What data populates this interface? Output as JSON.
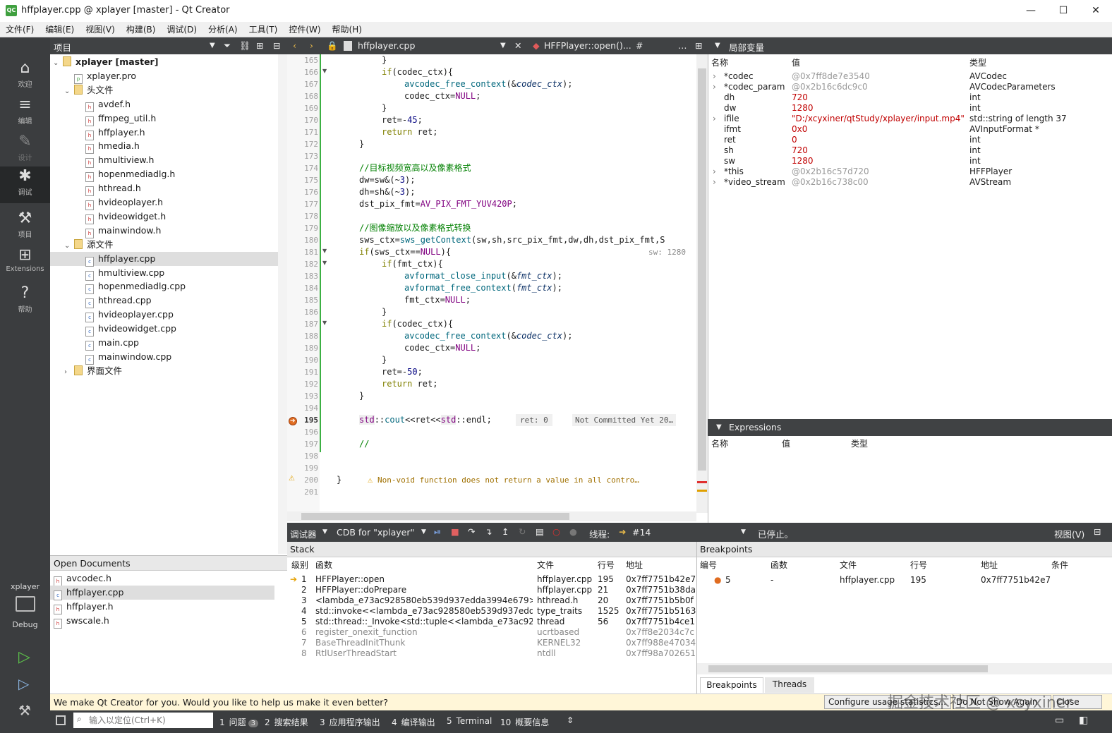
{
  "window": {
    "title": "hffplayer.cpp @ xplayer [master] - Qt Creator",
    "logo": "QC"
  },
  "menu": [
    "文件(F)",
    "编辑(E)",
    "视图(V)",
    "构建(B)",
    "调试(D)",
    "分析(A)",
    "工具(T)",
    "控件(W)",
    "帮助(H)"
  ],
  "modes": [
    {
      "label": "欢迎",
      "icon": "⌂"
    },
    {
      "label": "编辑",
      "icon": "≡"
    },
    {
      "label": "设计",
      "icon": "✎"
    },
    {
      "label": "调试",
      "icon": "✱"
    },
    {
      "label": "项目",
      "icon": "⚒"
    },
    {
      "label": "Extensions",
      "icon": "⊞"
    },
    {
      "label": "帮助",
      "icon": "?"
    }
  ],
  "kit": {
    "project": "xplayer",
    "config": "Debug"
  },
  "project_panel": {
    "title": "项目"
  },
  "tree": [
    {
      "label": "xplayer [master]",
      "level": 0,
      "type": "project"
    },
    {
      "label": "xplayer.pro",
      "level": 1,
      "type": "pro"
    },
    {
      "label": "头文件",
      "level": 1,
      "type": "folder"
    },
    {
      "label": "avdef.h",
      "level": 2,
      "type": "h"
    },
    {
      "label": "ffmpeg_util.h",
      "level": 2,
      "type": "h"
    },
    {
      "label": "hffplayer.h",
      "level": 2,
      "type": "h"
    },
    {
      "label": "hmedia.h",
      "level": 2,
      "type": "h"
    },
    {
      "label": "hmultiview.h",
      "level": 2,
      "type": "h"
    },
    {
      "label": "hopenmediadlg.h",
      "level": 2,
      "type": "h"
    },
    {
      "label": "hthread.h",
      "level": 2,
      "type": "h"
    },
    {
      "label": "hvideoplayer.h",
      "level": 2,
      "type": "h"
    },
    {
      "label": "hvideowidget.h",
      "level": 2,
      "type": "h"
    },
    {
      "label": "mainwindow.h",
      "level": 2,
      "type": "h"
    },
    {
      "label": "源文件",
      "level": 1,
      "type": "folder"
    },
    {
      "label": "hffplayer.cpp",
      "level": 2,
      "type": "cpp"
    },
    {
      "label": "hmultiview.cpp",
      "level": 2,
      "type": "cpp"
    },
    {
      "label": "hopenmediadlg.cpp",
      "level": 2,
      "type": "cpp"
    },
    {
      "label": "hthread.cpp",
      "level": 2,
      "type": "cpp"
    },
    {
      "label": "hvideoplayer.cpp",
      "level": 2,
      "type": "cpp"
    },
    {
      "label": "hvideowidget.cpp",
      "level": 2,
      "type": "cpp"
    },
    {
      "label": "main.cpp",
      "level": 2,
      "type": "cpp"
    },
    {
      "label": "mainwindow.cpp",
      "level": 2,
      "type": "cpp"
    },
    {
      "label": "界面文件",
      "level": 1,
      "type": "folder"
    }
  ],
  "open_documents": {
    "title": "Open Documents",
    "items": [
      "avcodec.h",
      "hffplayer.cpp",
      "hffplayer.h",
      "swscale.h"
    ]
  },
  "editor": {
    "file": "hffplayer.cpp",
    "symbol": "HFFPlayer::open()...",
    "hash": "#",
    "line_numbers": [
      "165",
      "166",
      "167",
      "168",
      "169",
      "170",
      "171",
      "172",
      "173",
      "174",
      "175",
      "176",
      "177",
      "178",
      "179",
      "180",
      "181",
      "182",
      "183",
      "184",
      "185",
      "186",
      "187",
      "188",
      "189",
      "190",
      "191",
      "192",
      "193",
      "194",
      "195",
      "196",
      "197",
      "198",
      "199",
      "200",
      "201"
    ],
    "annotations": {
      "sw": "sw: 1280",
      "ret": "ret: 0",
      "not_committed": "Not Committed Yet 20…",
      "warning": "Non-void function does not return a value in all contro…"
    }
  },
  "locals": {
    "title": "局部变量",
    "headers": [
      "名称",
      "值",
      "类型"
    ],
    "rows": [
      {
        "name": "*codec",
        "value": "@0x7ff8de7e3540",
        "type": "AVCodec",
        "expand": true,
        "grey": true
      },
      {
        "name": "*codec_param",
        "value": "@0x2b16c6dc9c0",
        "type": "AVCodecParameters",
        "expand": true,
        "grey": true
      },
      {
        "name": "dh",
        "value": "720",
        "type": "int",
        "expand": false,
        "grey": false
      },
      {
        "name": "dw",
        "value": "1280",
        "type": "int",
        "expand": false,
        "grey": false
      },
      {
        "name": "ifile",
        "value": "\"D:/xcyxiner/qtStudy/xplayer/input.mp4\"",
        "type": "std::string of length 37",
        "expand": true,
        "grey": false
      },
      {
        "name": "ifmt",
        "value": "0x0",
        "type": "AVInputFormat *",
        "expand": false,
        "grey": false
      },
      {
        "name": "ret",
        "value": "0",
        "type": "int",
        "expand": false,
        "grey": false
      },
      {
        "name": "sh",
        "value": "720",
        "type": "int",
        "expand": false,
        "grey": false
      },
      {
        "name": "sw",
        "value": "1280",
        "type": "int",
        "expand": false,
        "grey": false
      },
      {
        "name": "*this",
        "value": "@0x2b16c57d720",
        "type": "HFFPlayer",
        "expand": true,
        "grey": true
      },
      {
        "name": "*video_stream",
        "value": "@0x2b16c738c00",
        "type": "AVStream",
        "expand": true,
        "grey": true
      }
    ]
  },
  "expressions": {
    "title": "Expressions",
    "headers": [
      "名称",
      "值",
      "类型"
    ]
  },
  "debugger_bar": {
    "debugger": "调试器",
    "engine": "CDB for \"xplayer\"",
    "thread_label": "线程:",
    "thread": "#14",
    "state": "已停止。",
    "view": "视图(V)"
  },
  "stack": {
    "title": "Stack",
    "headers": [
      "级别",
      "函数",
      "文件",
      "行号",
      "地址"
    ],
    "rows": [
      {
        "level": "1",
        "func": "HFFPlayer::open",
        "file": "hffplayer.cpp",
        "line": "195",
        "addr": "0x7ff7751b42e7",
        "grey": false,
        "current": true
      },
      {
        "level": "2",
        "func": "HFFPlayer::doPrepare",
        "file": "hffplayer.cpp",
        "line": "21",
        "addr": "0x7ff7751b38da",
        "grey": false,
        "current": false
      },
      {
        "level": "3",
        "func": "<lambda_e73ac928580eb539d937edda3994e679>::…",
        "file": "hthread.h",
        "line": "20",
        "addr": "0x7ff7751b5b0f",
        "grey": false,
        "current": false
      },
      {
        "level": "4",
        "func": "std::invoke<<lambda_e73ac928580eb539d937edd…",
        "file": "type_traits",
        "line": "1525",
        "addr": "0x7ff7751b5163",
        "grey": false,
        "current": false
      },
      {
        "level": "5",
        "func": "std::thread::_Invoke<std::tuple<<lambda_e73ac928…",
        "file": "thread",
        "line": "56",
        "addr": "0x7ff7751b4ce1",
        "grey": false,
        "current": false
      },
      {
        "level": "6",
        "func": "register_onexit_function",
        "file": "ucrtbased",
        "line": "",
        "addr": "0x7ff8e2034c7c",
        "grey": true,
        "current": false
      },
      {
        "level": "7",
        "func": "BaseThreadInitThunk",
        "file": "KERNEL32",
        "line": "",
        "addr": "0x7ff988e47034",
        "grey": true,
        "current": false
      },
      {
        "level": "8",
        "func": "RtlUserThreadStart",
        "file": "ntdll",
        "line": "",
        "addr": "0x7ff98a702651",
        "grey": true,
        "current": false
      }
    ]
  },
  "breakpoints": {
    "title": "Breakpoints",
    "headers": [
      "编号",
      "函数",
      "文件",
      "行号",
      "地址",
      "条件"
    ],
    "rows": [
      {
        "num": "5",
        "func": "-",
        "file": "hffplayer.cpp",
        "line": "195",
        "addr": "0x7ff7751b42e7",
        "cond": ""
      }
    ],
    "tabs": [
      "Breakpoints",
      "Threads"
    ]
  },
  "notice": {
    "text": "We make Qt Creator for you. Would you like to help us make it even better?",
    "button": "Configure usage statistics...",
    "button2": "Do Not Show Again",
    "button3": "Close"
  },
  "watermark": "掘金技术社区 @ xcyxiner",
  "statusbar": {
    "locator_placeholder": "输入以定位(Ctrl+K)",
    "tabs": [
      {
        "num": "1",
        "label": "问题",
        "badge": "3"
      },
      {
        "num": "2",
        "label": "搜索结果",
        "badge": ""
      },
      {
        "num": "3",
        "label": "应用程序输出",
        "badge": ""
      },
      {
        "num": "4",
        "label": "编译输出",
        "badge": ""
      },
      {
        "num": "5",
        "label": "Terminal",
        "badge": ""
      },
      {
        "num": "10",
        "label": "概要信息",
        "badge": ""
      }
    ]
  },
  "colors": {
    "sidebar": "#3b3d3f",
    "header": "#404244",
    "breakpoint": "#e06c20",
    "keyword": "#808000",
    "comment": "#008000"
  }
}
